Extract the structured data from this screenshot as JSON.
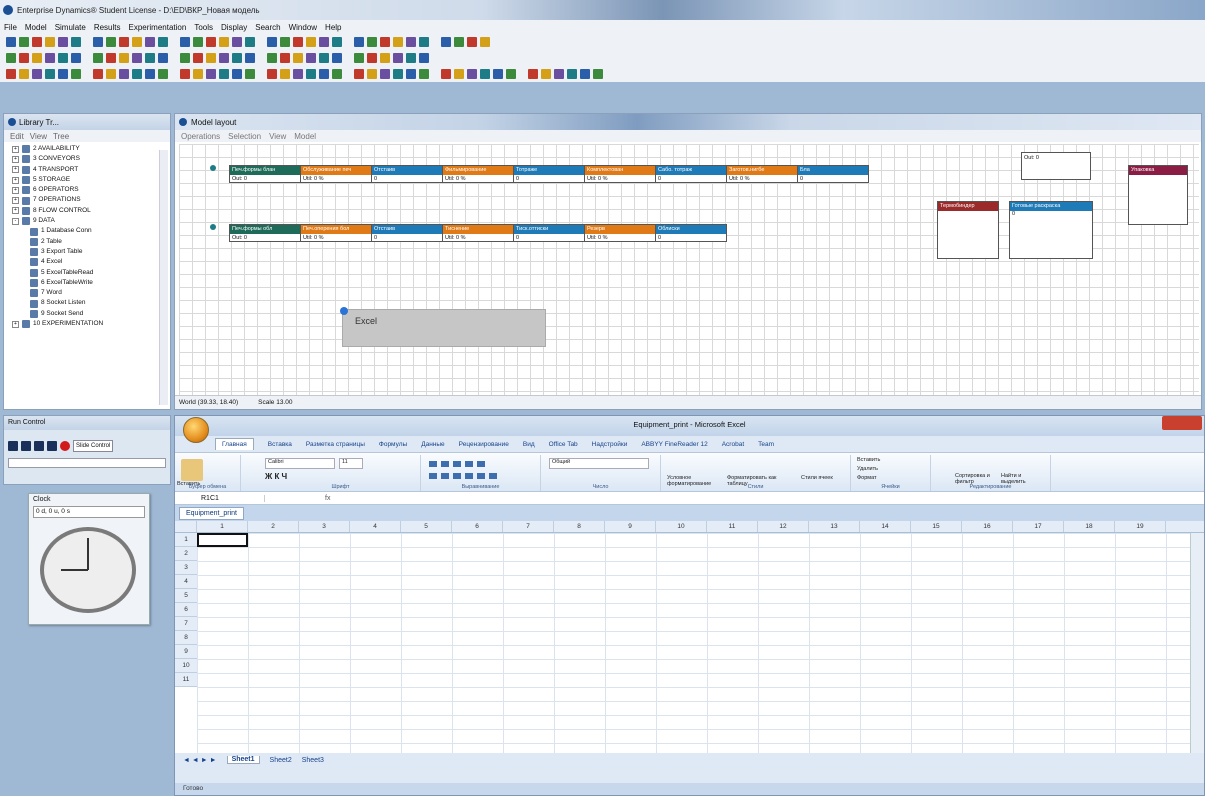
{
  "app": {
    "title": "Enterprise Dynamics® Student License - D:\\ED\\ВКР_Новая модель"
  },
  "menu": [
    "File",
    "Model",
    "Simulate",
    "Results",
    "Experimentation",
    "Tools",
    "Display",
    "Search",
    "Window",
    "Help"
  ],
  "library": {
    "title": "Library Tr...",
    "tabs": [
      "Edit",
      "View",
      "Tree"
    ],
    "items": [
      {
        "label": "2 AVAILABILITY",
        "pm": "+",
        "level": 0
      },
      {
        "label": "3 CONVEYORS",
        "pm": "+",
        "level": 0
      },
      {
        "label": "4 TRANSPORT",
        "pm": "+",
        "level": 0
      },
      {
        "label": "5 STORAGE",
        "pm": "+",
        "level": 0
      },
      {
        "label": "6 OPERATORS",
        "pm": "+",
        "level": 0
      },
      {
        "label": "7 OPERATIONS",
        "pm": "+",
        "level": 0
      },
      {
        "label": "8 FLOW CONTROL",
        "pm": "+",
        "level": 0
      },
      {
        "label": "9 DATA",
        "pm": "-",
        "level": 0
      },
      {
        "label": "1 Database Conn",
        "pm": "",
        "level": 1
      },
      {
        "label": "2 Table",
        "pm": "",
        "level": 1
      },
      {
        "label": "3 Export Table",
        "pm": "",
        "level": 1
      },
      {
        "label": "4 Excel",
        "pm": "",
        "level": 1
      },
      {
        "label": "5 ExcelTableRead",
        "pm": "",
        "level": 1
      },
      {
        "label": "6 ExcelTableWrite",
        "pm": "",
        "level": 1
      },
      {
        "label": "7 Word",
        "pm": "",
        "level": 1
      },
      {
        "label": "8 Socket Listen",
        "pm": "",
        "level": 1
      },
      {
        "label": "9 Socket Send",
        "pm": "",
        "level": 1
      },
      {
        "label": "10 EXPERIMENTATION",
        "pm": "+",
        "level": 0
      }
    ]
  },
  "model": {
    "title": "Model layout",
    "submenu": [
      "Operations",
      "Selection",
      "View",
      "Model"
    ],
    "status_world": "World (39.33, 18.40)",
    "status_scale": "Scale 13.00",
    "row1": [
      {
        "title": "Печ.формы блан",
        "val": "Out: 0",
        "color": "g"
      },
      {
        "title": "Обслуживание печ",
        "val": "Util: 0 %",
        "color": "o"
      },
      {
        "title": "Отстаив",
        "val": "0",
        "color": "b"
      },
      {
        "title": "Фильмирование",
        "val": "Util: 0 %",
        "color": "o"
      },
      {
        "title": "Тотраже",
        "val": "0",
        "color": "b"
      },
      {
        "title": "Комплектован",
        "val": "Util: 0 %",
        "color": "o"
      },
      {
        "title": "Сабо. тотраж",
        "val": "0",
        "color": "b"
      },
      {
        "title": "Заготов.нигбе",
        "val": "Util: 0 %",
        "color": "o"
      },
      {
        "title": "Бла",
        "val": "0",
        "color": "b"
      }
    ],
    "row2": [
      {
        "title": "Печ.формы обл",
        "val": "Out: 0",
        "color": "g"
      },
      {
        "title": "Печ.оперения бол",
        "val": "Util: 0 %",
        "color": "o"
      },
      {
        "title": "Отстаив",
        "val": "0",
        "color": "b"
      },
      {
        "title": "Тиснение",
        "val": "Util: 0 %",
        "color": "o"
      },
      {
        "title": "Тиск.оттиски",
        "val": "0",
        "color": "b"
      },
      {
        "title": "Резерв",
        "val": "Util: 0 %",
        "color": "o"
      },
      {
        "title": "Облиски",
        "val": "0",
        "color": "b"
      }
    ],
    "extra": {
      "topbox_val": "Out: 0",
      "box_a": "Термобиндер",
      "box_b": "Готовые раскраска",
      "box_b_val": "0",
      "box_c": "Упаковка"
    },
    "excel_block": "Excel"
  },
  "run_control": {
    "title": "Run Control",
    "speed": "Slide Control"
  },
  "clock": {
    "title": "Clock",
    "readout": "0 d, 0 u, 0 s"
  },
  "excel": {
    "title": "Equipment_print - Microsoft Excel",
    "tabs": [
      "Главная",
      "Вставка",
      "Разметка страницы",
      "Формулы",
      "Данные",
      "Рецензирование",
      "Вид",
      "Office Tab",
      "Надстройки",
      "ABBYY FineReader 12",
      "Acrobat",
      "Team"
    ],
    "groups": [
      "Буфер обмена",
      "Шрифт",
      "Выравнивание",
      "Число",
      "Стили",
      "Ячейки",
      "Редактирование"
    ],
    "font": "Calibri",
    "size": "11",
    "format": "Общий",
    "paste": "Вставить",
    "cond": "Условное форматирование",
    "fmt_table": "Форматировать как таблицу",
    "cell_styles": "Стили ячеек",
    "insert": "Вставить",
    "delete": "Удалить",
    "format_btn": "Формат",
    "sort": "Сортировка и фильтр",
    "find": "Найти и выделить",
    "namebox": "R1C1",
    "fx": "fx",
    "workbook_tab": "Equipment_print",
    "columns": [
      "1",
      "2",
      "3",
      "4",
      "5",
      "6",
      "7",
      "8",
      "9",
      "10",
      "11",
      "12",
      "13",
      "14",
      "15",
      "16",
      "17",
      "18",
      "19"
    ],
    "rows": [
      "1",
      "2",
      "3",
      "4",
      "5",
      "6",
      "7",
      "8",
      "9",
      "10",
      "11"
    ],
    "sheets": [
      "Sheet1",
      "Sheet2",
      "Sheet3"
    ],
    "status": "Готово"
  }
}
